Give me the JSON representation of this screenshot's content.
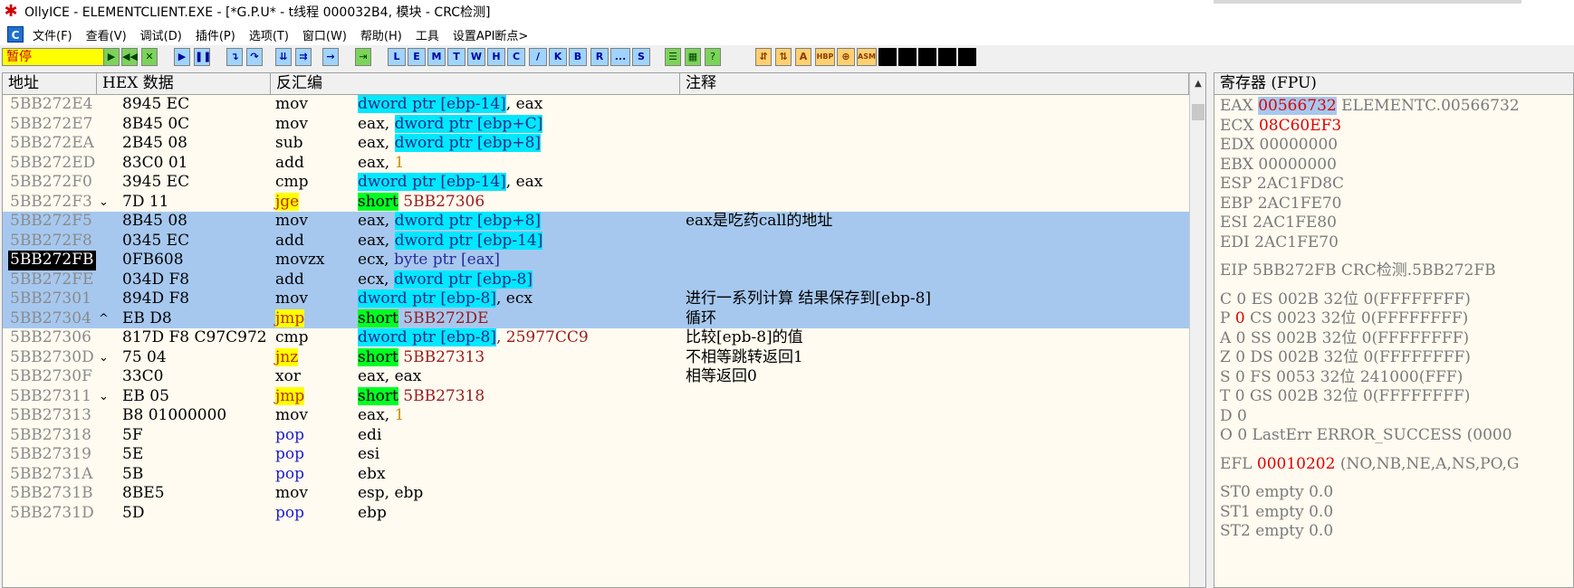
{
  "window": {
    "title": "OllyICE - ELEMENTCLIENT.EXE - [*G.P.U* - t线程  000032B4, 模块 - CRC检测]"
  },
  "menu": [
    "文件(F)",
    "查看(V)",
    "调试(D)",
    "插件(P)",
    "选项(T)",
    "窗口(W)",
    "帮助(H)",
    "工具",
    "设置API断点>"
  ],
  "toolbar": {
    "status": "暂停",
    "letters": [
      "L",
      "E",
      "M",
      "T",
      "W",
      "H",
      "C",
      "/",
      "K",
      "B",
      "R",
      "...",
      "S"
    ],
    "tools": [
      "HBP",
      "ASM"
    ]
  },
  "disasm": {
    "headers": {
      "addr": "地址",
      "hex": "HEX 数据",
      "disasm": "反汇编",
      "comment": "注释"
    },
    "rows": [
      {
        "addr": "5BB272E4",
        "arrow": "",
        "hex": "8945 EC",
        "mn": "mov",
        "ops": [
          {
            "t": "dword ptr [ebp-14]",
            "c": "mem"
          },
          {
            "t": ", eax",
            "c": ""
          }
        ],
        "cm": "",
        "sel": false
      },
      {
        "addr": "5BB272E7",
        "arrow": "",
        "hex": "8B45 0C",
        "mn": "mov",
        "ops": [
          {
            "t": "eax, ",
            "c": ""
          },
          {
            "t": "dword ptr [ebp+C]",
            "c": "mem"
          }
        ],
        "cm": "",
        "sel": false
      },
      {
        "addr": "5BB272EA",
        "arrow": "",
        "hex": "2B45 08",
        "mn": "sub",
        "ops": [
          {
            "t": "eax, ",
            "c": ""
          },
          {
            "t": "dword ptr [ebp+8]",
            "c": "mem"
          }
        ],
        "cm": "",
        "sel": false
      },
      {
        "addr": "5BB272ED",
        "arrow": "",
        "hex": "83C0 01",
        "mn": "add",
        "ops": [
          {
            "t": "eax, ",
            "c": ""
          },
          {
            "t": "1",
            "c": "num"
          }
        ],
        "cm": "",
        "sel": false
      },
      {
        "addr": "5BB272F0",
        "arrow": "",
        "hex": "3945 EC",
        "mn": "cmp",
        "ops": [
          {
            "t": "dword ptr [ebp-14]",
            "c": "mem"
          },
          {
            "t": ", eax",
            "c": ""
          }
        ],
        "cm": "",
        "sel": false
      },
      {
        "addr": "5BB272F3",
        "arrow": "⌄",
        "hex": "7D 11",
        "mn": "jge",
        "mc": "jmp",
        "ops": [
          {
            "t": "short",
            "c": "short"
          },
          {
            "t": " 5BB27306",
            "c": "tgt"
          }
        ],
        "cm": "",
        "sel": false
      },
      {
        "addr": "5BB272F5",
        "arrow": "",
        "hex": "8B45 08",
        "mn": "mov",
        "ops": [
          {
            "t": "eax, ",
            "c": ""
          },
          {
            "t": "dword ptr [ebp+8]",
            "c": "mem"
          }
        ],
        "cm": "eax是吃药call的地址",
        "sel": true
      },
      {
        "addr": "5BB272F8",
        "arrow": "",
        "hex": "0345 EC",
        "mn": "add",
        "ops": [
          {
            "t": "eax, ",
            "c": ""
          },
          {
            "t": "dword ptr [ebp-14]",
            "c": "mem"
          }
        ],
        "cm": "",
        "sel": true
      },
      {
        "addr": "5BB272FB",
        "arrow": "",
        "hex": "0FB608",
        "mn": "movzx",
        "ops": [
          {
            "t": "ecx, ",
            "c": ""
          },
          {
            "t": "byte ptr [eax]",
            "c": "mem2"
          }
        ],
        "cm": "",
        "sel": true,
        "cur": true
      },
      {
        "addr": "5BB272FE",
        "arrow": "",
        "hex": "034D F8",
        "mn": "add",
        "ops": [
          {
            "t": "ecx, ",
            "c": ""
          },
          {
            "t": "dword ptr [ebp-8]",
            "c": "mem"
          }
        ],
        "cm": "",
        "sel": true
      },
      {
        "addr": "5BB27301",
        "arrow": "",
        "hex": "894D F8",
        "mn": "mov",
        "ops": [
          {
            "t": "dword ptr [ebp-8]",
            "c": "mem"
          },
          {
            "t": ", ecx",
            "c": ""
          }
        ],
        "cm": "进行一系列计算 结果保存到[ebp-8]",
        "sel": true
      },
      {
        "addr": "5BB27304",
        "arrow": "^",
        "hex": "EB D8",
        "mn": "jmp",
        "mc": "jmp",
        "ops": [
          {
            "t": "short",
            "c": "short"
          },
          {
            "t": " 5BB272DE",
            "c": "tgt"
          }
        ],
        "cm": "循环",
        "sel": true
      },
      {
        "addr": "5BB27306",
        "arrow": "",
        "hex": "817D F8 C97C972",
        "mn": "cmp",
        "ops": [
          {
            "t": "dword ptr [ebp-8]",
            "c": "mem"
          },
          {
            "t": ", 25977CC9",
            "c": "tgt"
          }
        ],
        "cm": "比较[epb-8]的值",
        "sel": false
      },
      {
        "addr": "5BB2730D",
        "arrow": "⌄",
        "hex": "75 04",
        "mn": "jnz",
        "mc": "jmp",
        "ops": [
          {
            "t": "short",
            "c": "short"
          },
          {
            "t": " 5BB27313",
            "c": "tgt"
          }
        ],
        "cm": "不相等跳转返回1",
        "sel": false
      },
      {
        "addr": "5BB2730F",
        "arrow": "",
        "hex": "33C0",
        "mn": "xor",
        "ops": [
          {
            "t": "eax, eax",
            "c": ""
          }
        ],
        "cm": "相等返回0",
        "sel": false
      },
      {
        "addr": "5BB27311",
        "arrow": "⌄",
        "hex": "EB 05",
        "mn": "jmp",
        "mc": "jmp",
        "ops": [
          {
            "t": "short",
            "c": "short"
          },
          {
            "t": " 5BB27318",
            "c": "tgt"
          }
        ],
        "cm": "",
        "sel": false
      },
      {
        "addr": "5BB27313",
        "arrow": "",
        "hex": "B8 01000000",
        "mn": "mov",
        "ops": [
          {
            "t": "eax, ",
            "c": ""
          },
          {
            "t": "1",
            "c": "num"
          }
        ],
        "cm": "",
        "sel": false
      },
      {
        "addr": "5BB27318",
        "arrow": "",
        "hex": "5F",
        "mn": "pop",
        "mc": "pop",
        "ops": [
          {
            "t": "edi",
            "c": ""
          }
        ],
        "cm": "",
        "sel": false
      },
      {
        "addr": "5BB27319",
        "arrow": "",
        "hex": "5E",
        "mn": "pop",
        "mc": "pop",
        "ops": [
          {
            "t": "esi",
            "c": ""
          }
        ],
        "cm": "",
        "sel": false
      },
      {
        "addr": "5BB2731A",
        "arrow": "",
        "hex": "5B",
        "mn": "pop",
        "mc": "pop",
        "ops": [
          {
            "t": "ebx",
            "c": ""
          }
        ],
        "cm": "",
        "sel": false
      },
      {
        "addr": "5BB2731B",
        "arrow": "",
        "hex": "8BE5",
        "mn": "mov",
        "ops": [
          {
            "t": "esp, ebp",
            "c": ""
          }
        ],
        "cm": "",
        "sel": false
      },
      {
        "addr": "5BB2731D",
        "arrow": "",
        "hex": "5D",
        "mn": "pop",
        "mc": "pop",
        "ops": [
          {
            "t": "ebp",
            "c": ""
          }
        ],
        "cm": "",
        "sel": false
      }
    ]
  },
  "registers": {
    "header": "寄存器 (FPU)",
    "lines": [
      {
        "segs": [
          {
            "t": "EAX "
          },
          {
            "t": "00566732",
            "c": "hi"
          },
          {
            "t": " ELEMENTC.00566732"
          }
        ]
      },
      {
        "segs": [
          {
            "t": "ECX "
          },
          {
            "t": "08C60EF3",
            "c": "red"
          }
        ]
      },
      {
        "segs": [
          {
            "t": "EDX 00000000"
          }
        ]
      },
      {
        "segs": [
          {
            "t": "EBX 00000000"
          }
        ]
      },
      {
        "segs": [
          {
            "t": "ESP 2AC1FD8C"
          }
        ]
      },
      {
        "segs": [
          {
            "t": "EBP 2AC1FE70"
          }
        ]
      },
      {
        "segs": [
          {
            "t": "ESI 2AC1FE80"
          }
        ]
      },
      {
        "segs": [
          {
            "t": "EDI 2AC1FE70"
          }
        ]
      },
      {
        "gap": true,
        "segs": [
          {
            "t": "EIP 5BB272FB CRC检测.5BB272FB"
          }
        ]
      },
      {
        "gap": true,
        "segs": [
          {
            "t": "C 0   ES 002B 32位 0(FFFFFFFF)"
          }
        ]
      },
      {
        "segs": [
          {
            "t": "P "
          },
          {
            "t": "0",
            "c": "red"
          },
          {
            "t": "   CS 0023 32位 0(FFFFFFFF)"
          }
        ]
      },
      {
        "segs": [
          {
            "t": "A 0   SS 002B 32位 0(FFFFFFFF)"
          }
        ]
      },
      {
        "segs": [
          {
            "t": "Z 0   DS 002B 32位 0(FFFFFFFF)"
          }
        ]
      },
      {
        "segs": [
          {
            "t": "S 0   FS 0053 32位 241000(FFF)"
          }
        ]
      },
      {
        "segs": [
          {
            "t": "T 0   GS 002B 32位 0(FFFFFFFF)"
          }
        ]
      },
      {
        "segs": [
          {
            "t": "D 0"
          }
        ]
      },
      {
        "segs": [
          {
            "t": "O 0   LastErr ERROR_SUCCESS (0000"
          }
        ]
      },
      {
        "gap": true,
        "segs": [
          {
            "t": "EFL "
          },
          {
            "t": "00010202",
            "c": "red"
          },
          {
            "t": " (NO,NB,NE,A,NS,PO,G"
          }
        ]
      },
      {
        "gap": true,
        "segs": [
          {
            "t": "ST0 empty 0.0"
          }
        ]
      },
      {
        "segs": [
          {
            "t": "ST1 empty 0.0"
          }
        ]
      },
      {
        "segs": [
          {
            "t": "ST2 empty 0.0"
          }
        ]
      }
    ]
  }
}
